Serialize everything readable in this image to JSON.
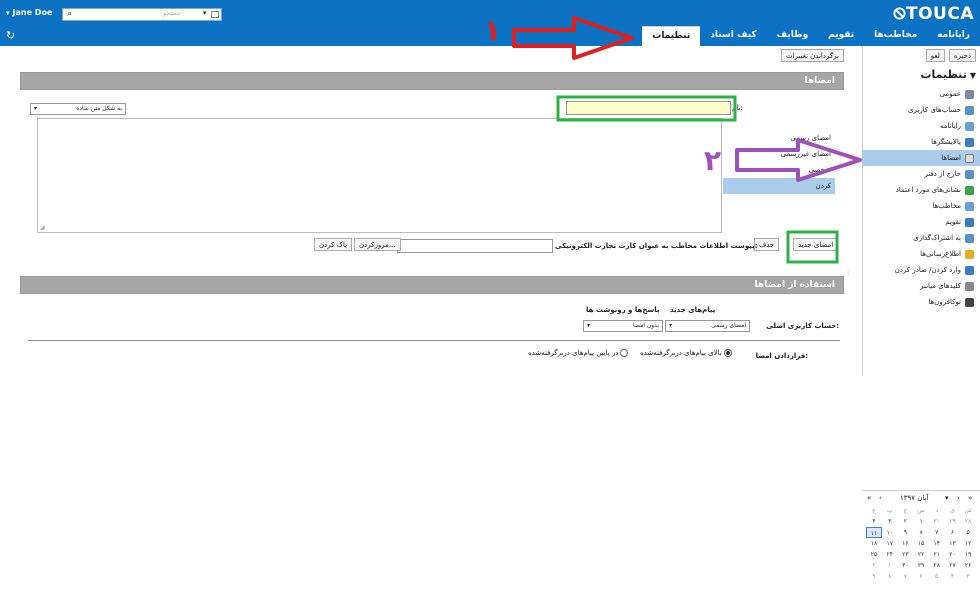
{
  "app": {
    "user": "Jane Doe",
    "search_placeholder": "جستجو",
    "logo": "TOUCA",
    "colors": {
      "header": "#0b72c4",
      "selected": "#a9cdea",
      "section_bar": "#a6a6a6",
      "highlight_input": "#fffec8",
      "annotation_red": "#e02020",
      "annotation_purple": "#a050b8",
      "annotation_green": "#2db24a"
    }
  },
  "nav": {
    "tabs": [
      "رایانامه",
      "مخاطب‌ها",
      "تقویم",
      "وظایف",
      "کیف اسناد",
      "تنظیمات"
    ],
    "active": "تنظیمات"
  },
  "sidebar": {
    "save": "ذخیره",
    "cancel": "لغو",
    "undo": "برگرداندن تغییرات",
    "title": "تنظیمات",
    "items": [
      {
        "label": "عمومی",
        "icon": "globe-icon",
        "color": "#7a8a9a"
      },
      {
        "label": "حساب‌های کاربری",
        "icon": "accounts-icon",
        "color": "#5b8fc8"
      },
      {
        "label": "رایانامه",
        "icon": "mail-icon",
        "color": "#6a9fd4"
      },
      {
        "label": "پالایشگرها",
        "icon": "filter-icon",
        "color": "#3a7cc2"
      },
      {
        "label": "امضاها",
        "icon": "signature-icon",
        "color": "#e0e0e0",
        "selected": true
      },
      {
        "label": "خارج از دفتر",
        "icon": "out-of-office-icon",
        "color": "#5b8fc8"
      },
      {
        "label": "نشانی‌های مورد اعتماد",
        "icon": "shield-icon",
        "color": "#3aa34a"
      },
      {
        "label": "مخاطب‌ها",
        "icon": "contacts-icon",
        "color": "#6a9fd4"
      },
      {
        "label": "تقویم",
        "icon": "calendar-icon",
        "color": "#3a7cc2"
      },
      {
        "label": "به اشتراک‌گذاری",
        "icon": "share-icon",
        "color": "#5b8fc8"
      },
      {
        "label": "اطلاع‌رسانی‌ها",
        "icon": "bell-icon",
        "color": "#e0b020"
      },
      {
        "label": "وارد کردن/ صادر کردن",
        "icon": "import-export-icon",
        "color": "#3a7cc2"
      },
      {
        "label": "کلیدهای میانبر",
        "icon": "keyboard-icon",
        "color": "#888888"
      },
      {
        "label": "توکافزون‌ها",
        "icon": "addons-icon",
        "color": "#444444"
      }
    ]
  },
  "signatures": {
    "section_title": "امضاها",
    "format_select": "به شکل متن ساده",
    "name_label": "نام:",
    "name_value": "",
    "list": [
      "امضای رسمی",
      "امضای غیررسمی",
      "شخصی",
      "کردن"
    ],
    "selected_index": 3,
    "new_button": "امضای جدید",
    "delete_button": "حذف",
    "vcard_label": "پیوست اطلاعات مخاطب به عنوان کارت تجارت الکترونیکی:",
    "browse_button": "مرورکردن...",
    "clear_button": "پاک کردن"
  },
  "usage": {
    "section_title": "استفاده از امضاها",
    "col_new": "پیام‌های جدید",
    "col_replies": "پاسخ‌ها و رونوشت ها",
    "account_label": "حساب کاربری اصلی:",
    "new_value": "امضای رسمی",
    "replies_value": "بدون امضا",
    "placement_label": "قراردادن امضا:",
    "radio_above": "بالای پیام‌های دربرگرفته‌شده",
    "radio_below": "در پایین پیام‌های دربرگرفته‌شده",
    "radio_selected": "above"
  },
  "calendar": {
    "month_label": "آبان ۱۳۹۷",
    "weekdays": [
      "ش",
      "ی",
      "د",
      "س",
      "چ",
      "پ",
      "ج"
    ],
    "weeks": [
      [
        "۲۸",
        "۲۹",
        "۳۰",
        "۱",
        "۲",
        "۳",
        "۴"
      ],
      [
        "۵",
        "۶",
        "۷",
        "۸",
        "۹",
        "۱۰",
        "۱۱"
      ],
      [
        "۱۲",
        "۱۳",
        "۱۴",
        "۱۵",
        "۱۶",
        "۱۷",
        "۱۸"
      ],
      [
        "۱۹",
        "۲۰",
        "۲۱",
        "۲۲",
        "۲۳",
        "۲۴",
        "۲۵"
      ],
      [
        "۲۶",
        "۲۷",
        "۲۸",
        "۲۹",
        "۳۰",
        "۱",
        "۲"
      ],
      [
        "۳",
        "۴",
        "۵",
        "۶",
        "۷",
        "۸",
        "۹"
      ]
    ],
    "today": "۱۱"
  },
  "annotations": {
    "step1": "۱",
    "step2": "۲"
  }
}
